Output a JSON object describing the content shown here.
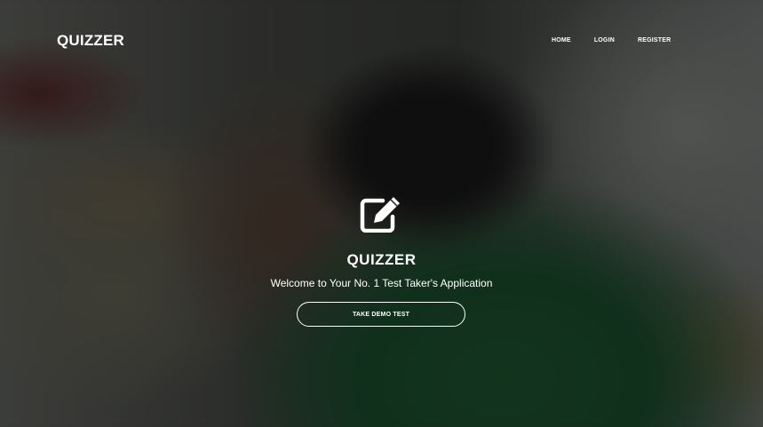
{
  "navbar": {
    "brand": "QUIZZER",
    "links": [
      "HOME",
      "LOGIN",
      "REGISTER"
    ]
  },
  "hero": {
    "icon": "edit-icon",
    "title": "QUIZZER",
    "tagline": "Welcome to Your No. 1 Test Taker's Application",
    "button_label": "TAKE DEMO TEST"
  },
  "colors": {
    "text": "#ffffff",
    "overlay": "rgba(0,0,0,0.42)"
  }
}
